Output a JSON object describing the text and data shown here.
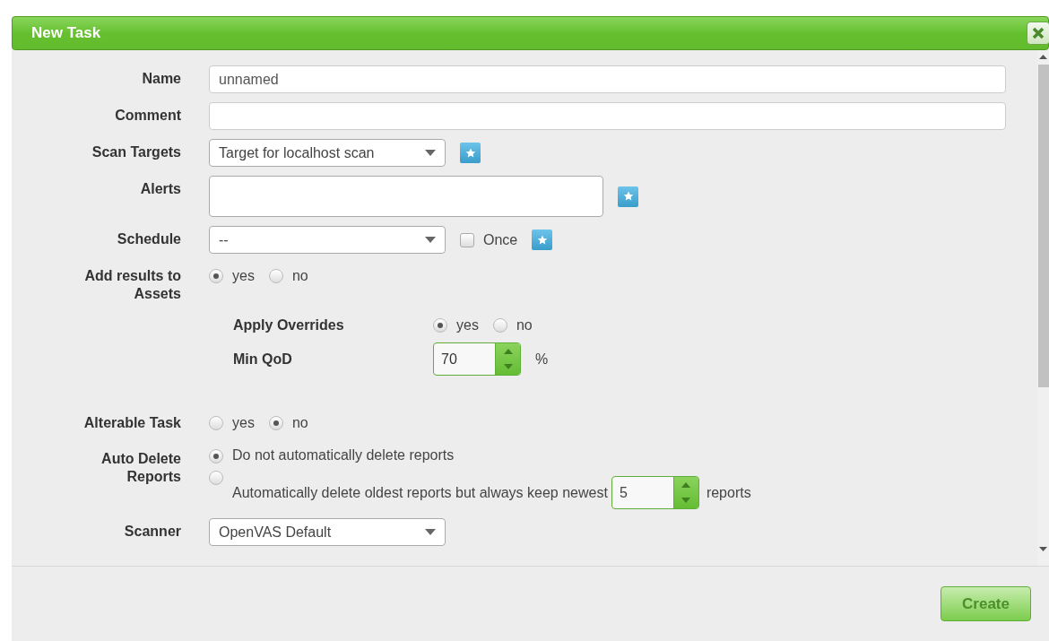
{
  "window": {
    "title": "New Task"
  },
  "rows": [
    {
      "kind": "text",
      "label": "Name",
      "value": "unnamed"
    },
    {
      "kind": "text",
      "label": "Comment"
    },
    {
      "kind": "select",
      "label": "Scan Targets",
      "value": "Target for localhost scan",
      "add_button": true
    },
    {
      "kind": "multiselect",
      "label": "Alerts",
      "add_button": true
    },
    {
      "kind": "select",
      "label": "Schedule",
      "value": "--",
      "checkbox": {
        "label": "Once",
        "checked": false
      },
      "add_button": true
    },
    {
      "kind": "radio",
      "label": "Add results to Assets",
      "options": [
        {
          "label": "yes",
          "selected": true
        },
        {
          "label": "no",
          "selected": false
        }
      ]
    },
    {
      "kind": "subsection",
      "rows": [
        {
          "kind": "radio",
          "label": "Apply Overrides",
          "options": [
            {
              "label": "yes",
              "selected": true
            },
            {
              "label": "no",
              "selected": false
            }
          ]
        },
        {
          "kind": "spinner",
          "label": "Min QoD",
          "value": "70",
          "unit": "%"
        }
      ]
    },
    {
      "kind": "radio",
      "label": "Alterable Task",
      "options": [
        {
          "label": "yes",
          "selected": false
        },
        {
          "label": "no",
          "selected": true
        }
      ]
    },
    {
      "kind": "radio_list",
      "label": "Auto Delete Reports",
      "options": [
        {
          "label": "Do not automatically delete reports",
          "selected": true
        },
        {
          "label": "Automatically delete oldest reports but always keep newest",
          "selected": false,
          "spinner": {
            "value": "5",
            "unit": "reports"
          }
        }
      ]
    },
    {
      "kind": "select",
      "label": "Scanner",
      "value": "OpenVAS Default"
    }
  ],
  "footer": {
    "button": "Create"
  }
}
